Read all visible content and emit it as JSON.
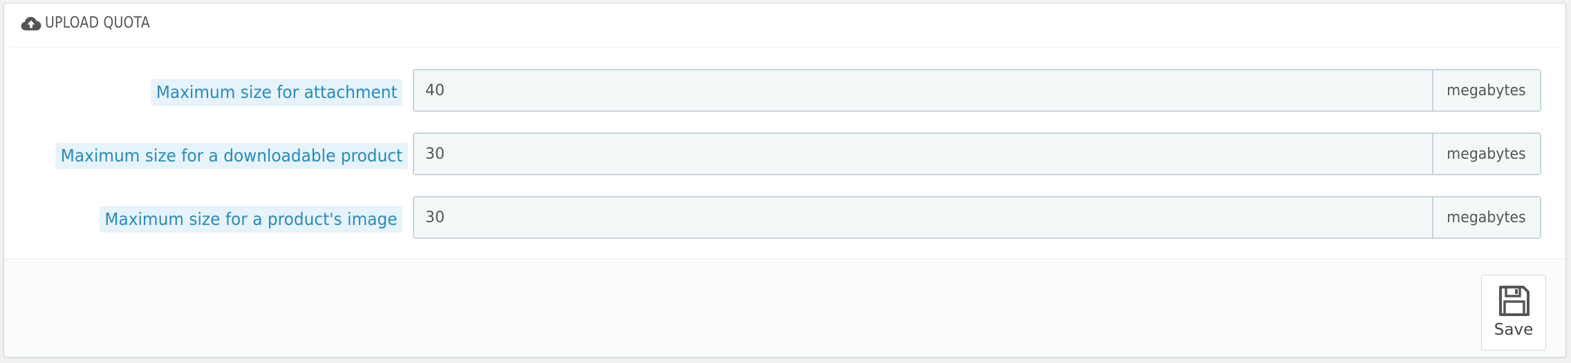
{
  "panel": {
    "title": "UPLOAD QUOTA",
    "icon": "cloud-upload-icon"
  },
  "fields": [
    {
      "label": "Maximum size for attachment",
      "value": "40",
      "unit": "megabytes"
    },
    {
      "label": "Maximum size for a downloadable product",
      "value": "30",
      "unit": "megabytes"
    },
    {
      "label": "Maximum size for a product's image",
      "value": "30",
      "unit": "megabytes"
    }
  ],
  "footer": {
    "save_label": "Save",
    "save_icon": "floppy-disk-icon"
  },
  "colors": {
    "label_text": "#2a8bb8",
    "label_background": "#e7f3fa",
    "input_background": "#f5f8f9",
    "input_border": "#c8d4da"
  }
}
